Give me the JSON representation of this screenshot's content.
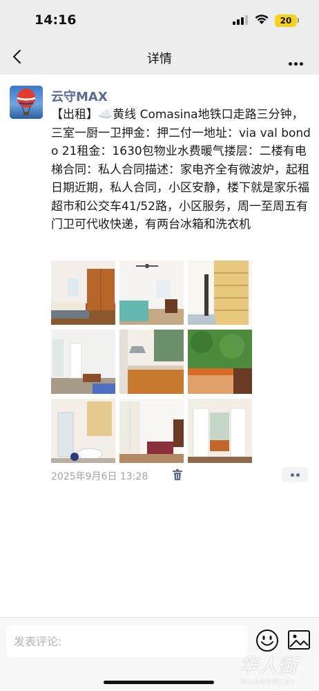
{
  "status_bar": {
    "time": "14:16",
    "battery": "20",
    "icons": [
      "signal-icon",
      "wifi-icon",
      "battery-icon"
    ]
  },
  "nav": {
    "title": "详情",
    "back_icon": "chevron-left-icon",
    "more_icon": "more-icon"
  },
  "post": {
    "username": "云守MAX",
    "text": "【出租】☁️黄线 Comasina地铁口走路三分钟，三室一厨一卫押金：押二付一地址：via val bondo 21租金：1630包物业水费暖气搂层：二楼有电梯合同：私人合同描述：家电齐全有微波炉，起租日期近期，私人合同，小区安静，楼下就是家乐福超市和公交车41/52路，小区服务，周一至周五有门卫可代收快递，有两台冰箱和洗衣机",
    "timestamp": "2025年9月6日 13:28",
    "photos": [
      "bedroom-wardrobe",
      "bedroom-bed",
      "shelf-room",
      "bathroom-window",
      "kitchen",
      "balcony",
      "bathroom",
      "bedroom-second",
      "balcony-door"
    ]
  },
  "bottom_bar": {
    "comment_placeholder": "发表评论:",
    "emoji_icon": "emoji-icon",
    "image_icon": "image-icon"
  },
  "watermark": {
    "cn": "华人街",
    "en": "HUARENJIEI"
  },
  "colors": {
    "link": "#576b95",
    "nav_bg": "#ededed",
    "battery": "#f6d21c"
  }
}
